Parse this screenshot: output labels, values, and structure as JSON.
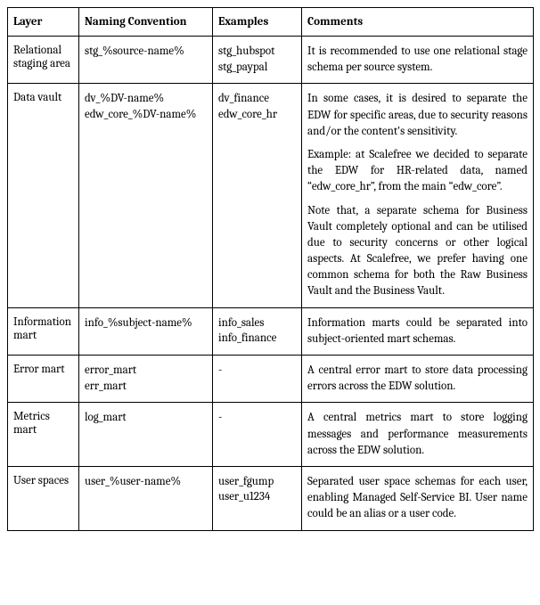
{
  "headers": {
    "layer": "Layer",
    "naming": "Naming Convention",
    "examples": "Examples",
    "comments": "Comments"
  },
  "rows": [
    {
      "layer": "Relational staging area",
      "naming": "stg_%source-name%",
      "examples": "stg_hubspot\nstg_paypal",
      "comments": [
        "It is recommended to use one relational stage schema per source system."
      ]
    },
    {
      "layer": "Data vault",
      "naming": "dv_%DV-name%\nedw_core_%DV-name%",
      "examples": "dv_finance\nedw_core_hr",
      "comments": [
        "In some cases, it is desired to separate the EDW for specific areas, due to security reasons and/or the content's sensitivity.",
        "Example: at Scalefree we decided to separate the EDW for HR-related data, named “edw_core_hr”, from the main “edw_core”.",
        "Note that, a separate schema for Business Vault completely optional and can be utilised due to security concerns or other logical aspects. At Scalefree, we prefer having one common schema for both the Raw Business Vault and the Business Vault."
      ]
    },
    {
      "layer": "Information mart",
      "naming": "info_%subject-name%",
      "examples": "info_sales\ninfo_finance",
      "comments": [
        "Information marts could be separated into subject-oriented mart schemas."
      ]
    },
    {
      "layer": "Error mart",
      "naming": "error_mart\nerr_mart",
      "examples": "-",
      "comments": [
        "A central error mart to store data processing errors across the EDW solution."
      ]
    },
    {
      "layer": "Metrics mart",
      "naming": "log_mart",
      "examples": "-",
      "comments": [
        "A central metrics mart to store logging messages and performance measurements across the EDW solution."
      ]
    },
    {
      "layer": "User spaces",
      "naming": "user_%user-name%",
      "examples": "user_fgump\nuser_u1234",
      "comments": [
        "Separated user space schemas for each user, enabling Managed Self-Service BI. User name could be an alias or a user code."
      ]
    }
  ]
}
